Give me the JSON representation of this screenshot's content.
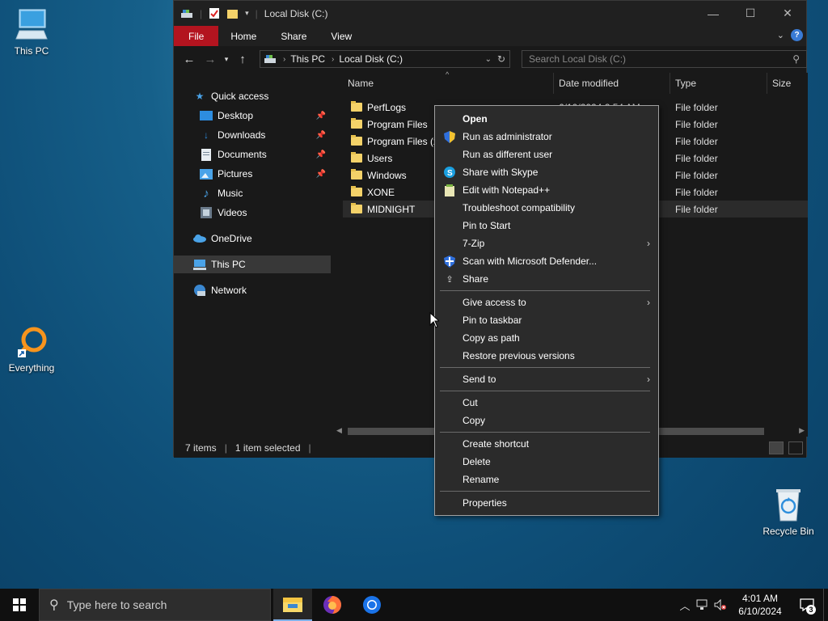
{
  "desktop": {
    "icons": [
      {
        "label": "This PC",
        "icon": "this-pc-icon"
      },
      {
        "label": "Everything",
        "icon": "everything-app-icon"
      },
      {
        "label": "Recycle Bin",
        "icon": "recycle-bin-icon"
      }
    ]
  },
  "window": {
    "title": "Local Disk (C:)",
    "controls": {
      "minimize": "—",
      "maximize": "☐",
      "close": "✕"
    }
  },
  "ribbon": {
    "tabs": [
      "File",
      "Home",
      "Share",
      "View"
    ],
    "help": "?"
  },
  "address": {
    "crumbs": [
      "This PC",
      "Local Disk (C:)"
    ],
    "search_placeholder": "Search Local Disk (C:)"
  },
  "nav": {
    "items": [
      {
        "label": "Quick access",
        "icon": "star-icon"
      },
      {
        "label": "Desktop",
        "icon": "desktop-folder-icon",
        "pinned": true
      },
      {
        "label": "Downloads",
        "icon": "downloads-icon",
        "pinned": true
      },
      {
        "label": "Documents",
        "icon": "documents-icon",
        "pinned": true
      },
      {
        "label": "Pictures",
        "icon": "pictures-icon",
        "pinned": true
      },
      {
        "label": "Music",
        "icon": "music-icon"
      },
      {
        "label": "Videos",
        "icon": "videos-icon"
      },
      {
        "label": "OneDrive",
        "icon": "onedrive-icon"
      },
      {
        "label": "This PC",
        "icon": "this-pc-icon",
        "selected": true
      },
      {
        "label": "Network",
        "icon": "network-icon"
      }
    ]
  },
  "columns": {
    "name": "Name",
    "date": "Date modified",
    "type": "Type",
    "size": "Size"
  },
  "files": [
    {
      "name": "PerfLogs",
      "date": "6/10/2024 2:54 AM",
      "type": "File folder"
    },
    {
      "name": "Program Files",
      "type": "File folder"
    },
    {
      "name": "Program Files (x",
      "type": "File folder"
    },
    {
      "name": "Users",
      "type": "File folder"
    },
    {
      "name": "Windows",
      "type": "File folder"
    },
    {
      "name": "XONE",
      "type": "File folder"
    },
    {
      "name": "MIDNIGHT",
      "type": "File folder",
      "selected": true
    }
  ],
  "status": {
    "items": "7 items",
    "selected": "1 item selected"
  },
  "context_menu": {
    "groups": [
      [
        {
          "label": "Open",
          "bold": true
        },
        {
          "label": "Run as administrator",
          "icon": "uac-shield-icon"
        },
        {
          "label": "Run as different user"
        },
        {
          "label": "Share with Skype",
          "icon": "skype-icon"
        },
        {
          "label": "Edit with Notepad++",
          "icon": "notepadpp-icon"
        },
        {
          "label": "Troubleshoot compatibility"
        },
        {
          "label": "Pin to Start"
        },
        {
          "label": "7-Zip",
          "submenu": true
        },
        {
          "label": "Scan with Microsoft Defender...",
          "icon": "defender-icon"
        },
        {
          "label": "Share",
          "icon": "share-icon"
        }
      ],
      [
        {
          "label": "Give access to",
          "submenu": true
        },
        {
          "label": "Pin to taskbar"
        },
        {
          "label": "Copy as path"
        },
        {
          "label": "Restore previous versions"
        }
      ],
      [
        {
          "label": "Send to",
          "submenu": true
        }
      ],
      [
        {
          "label": "Cut"
        },
        {
          "label": "Copy"
        }
      ],
      [
        {
          "label": "Create shortcut"
        },
        {
          "label": "Delete"
        },
        {
          "label": "Rename"
        }
      ],
      [
        {
          "label": "Properties"
        }
      ]
    ]
  },
  "taskbar": {
    "search_placeholder": "Type here to search",
    "apps": [
      "file-explorer-icon",
      "firefox-icon",
      "chrome-icon"
    ],
    "clock": {
      "time": "4:01 AM",
      "date": "6/10/2024"
    },
    "notification_count": "3"
  },
  "colors": {
    "file_tab": "#b3141f",
    "folder": "#f4d269",
    "accent": "#3a7bd5"
  }
}
